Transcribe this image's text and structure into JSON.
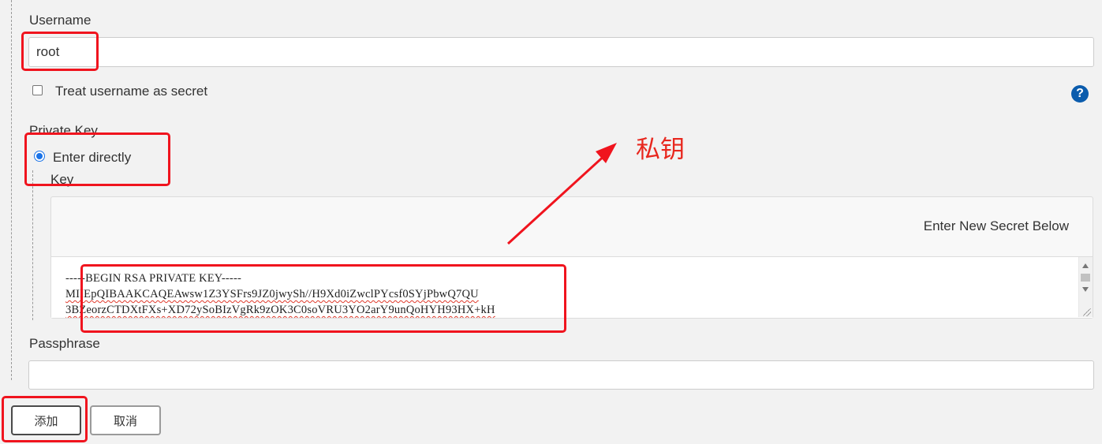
{
  "username": {
    "label": "Username",
    "value": "root",
    "treat_as_secret_label": "Treat username as secret",
    "treat_as_secret_checked": false
  },
  "help_icon": {
    "icon": "question-circle-icon",
    "glyph": "?"
  },
  "private_key": {
    "label": "Private Key",
    "option_label": "Enter directly",
    "option_selected": true,
    "key_label": "Key",
    "secret_header": "Enter New Secret Below",
    "key_lines": [
      "-----BEGIN RSA PRIVATE KEY-----",
      "MIIEpQIBAAKCAQEAwsw1Z3YSFrs9JZ0jwySh//H9Xd0iZwclPYcsf0SYjPbwQ7QU",
      "3BZeorzCTDXtFXs+XD72ySoBIzVgRk9zOK3C0soVRU3YO2arY9unQoHYH93HX+kH"
    ]
  },
  "passphrase": {
    "label": "Passphrase",
    "value": ""
  },
  "buttons": {
    "add_label": "添加",
    "cancel_label": "取消"
  },
  "annotation": {
    "text": "私钥",
    "color": "#e8271e"
  },
  "colors": {
    "background": "#f2f2f2",
    "highlight_red": "#f0141e",
    "radio_blue": "#1a73e8",
    "help_blue": "#0b5cad"
  }
}
